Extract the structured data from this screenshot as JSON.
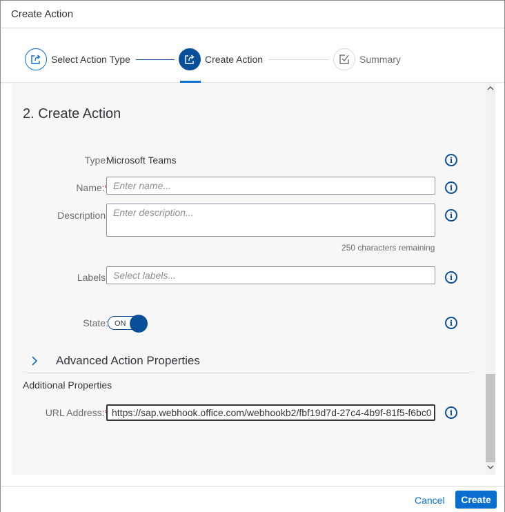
{
  "dialog": {
    "title": "Create Action"
  },
  "wizard": {
    "steps": [
      {
        "label": "Select Action Type",
        "icon": "share-icon",
        "status": "completed"
      },
      {
        "label": "Create Action",
        "icon": "share-icon",
        "status": "active"
      },
      {
        "label": "Summary",
        "icon": "task-icon",
        "status": "pending"
      }
    ]
  },
  "form": {
    "section_title": "2. Create Action",
    "type": {
      "label": "Type:",
      "value": "Microsoft Teams"
    },
    "name": {
      "label": "Name:",
      "required_mark": "*",
      "placeholder": "Enter name..."
    },
    "description": {
      "label": "Description:",
      "placeholder": "Enter description...",
      "counter": "250 characters remaining"
    },
    "labels": {
      "label": "Labels:",
      "placeholder": "Select labels..."
    },
    "state": {
      "label": "State:",
      "toggle_text": "ON",
      "on": true
    },
    "advanced": {
      "title": "Advanced Action Properties",
      "expanded": false
    },
    "additional": {
      "title": "Additional Properties",
      "url": {
        "label": "URL Address:",
        "required_mark": "*",
        "value": "https://sap.webhook.office.com/webhookb2/fbf19d7d-27c4-4b9f-81f5-f6bc0"
      }
    }
  },
  "footer": {
    "cancel_label": "Cancel",
    "create_label": "Create"
  },
  "colors": {
    "accent": "#0a6ed1",
    "accent_dark": "#0a4f9a",
    "required": "#bb0000",
    "content_bg": "#f7f7f7"
  }
}
